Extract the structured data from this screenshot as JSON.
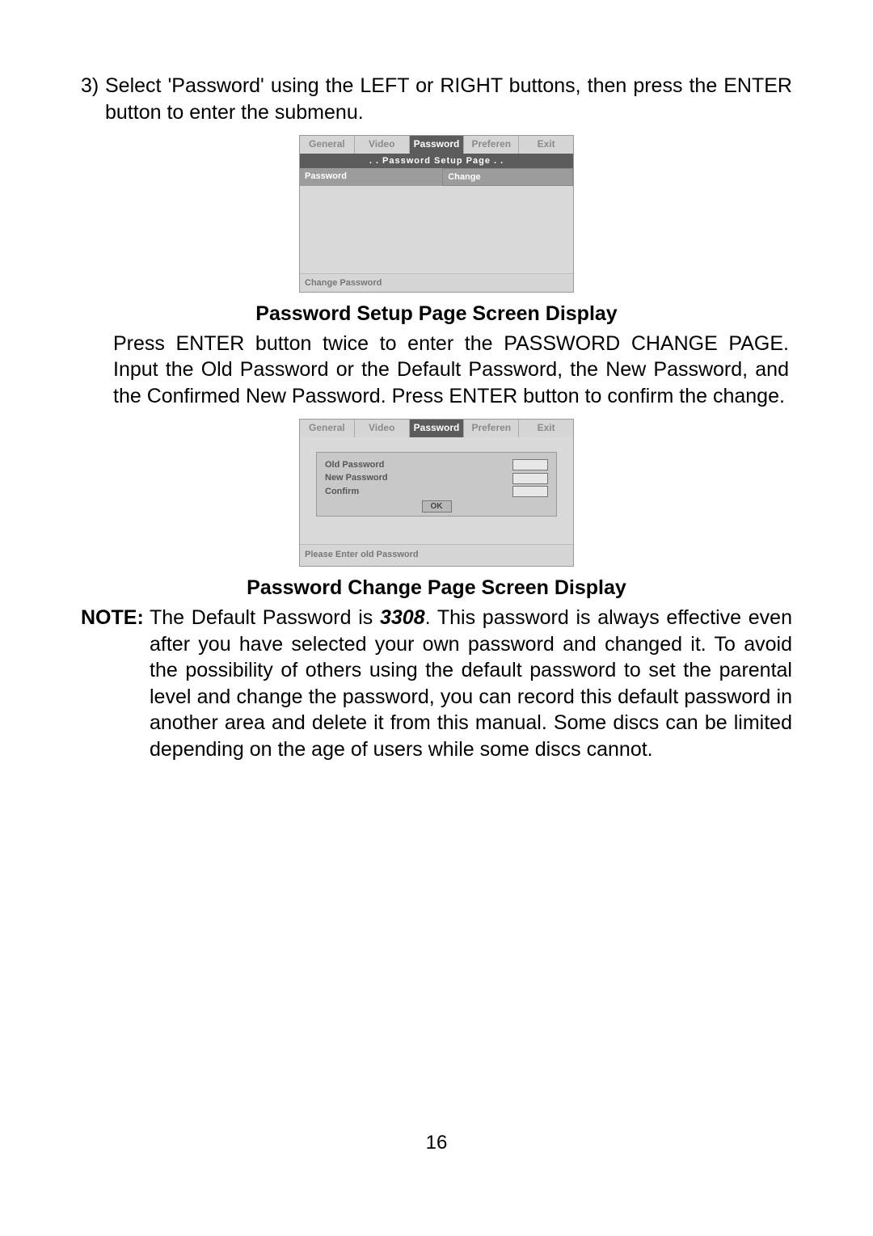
{
  "step": {
    "num": "3)",
    "text": "Select 'Password' using the  LEFT or RIGHT buttons, then press the ENTER button to enter the submenu."
  },
  "screenshot1": {
    "tabs": [
      "General",
      "Video",
      "Password",
      "Preferen",
      "Exit"
    ],
    "title": ". . Password  Setup  Page . .",
    "row_label": "Password",
    "row_value": "Change",
    "footer": "Change Password"
  },
  "caption1": "Password Setup Page Screen Display",
  "para1": "Press ENTER button twice to enter the PASSWORD CHANGE PAGE. Input the Old  Password or the Default Password, the New Password, and the Confirmed New Password. Press ENTER button to confirm the change.",
  "screenshot2": {
    "tabs": [
      "General",
      "Video",
      "Password",
      "Preferen",
      "Exit"
    ],
    "labels": {
      "old": "Old Password",
      "new": "New Password",
      "confirm": "Confirm"
    },
    "ok": "OK",
    "footer": "Please Enter old Password"
  },
  "caption2": "Password Change Page Screen Display",
  "note": {
    "label": "NOTE:",
    "lead": "The Default Password is ",
    "default_pwd": "3308",
    "rest": ".  This password  is always effective even after you have selected your own password and changed it. To avoid  the possibility of others using the default password to set the parental level and change the password, you can  record  this default password in another area  and delete it from this  manual. Some discs can be limited depending on the age of users while some discs cannot."
  },
  "page_number": "16"
}
